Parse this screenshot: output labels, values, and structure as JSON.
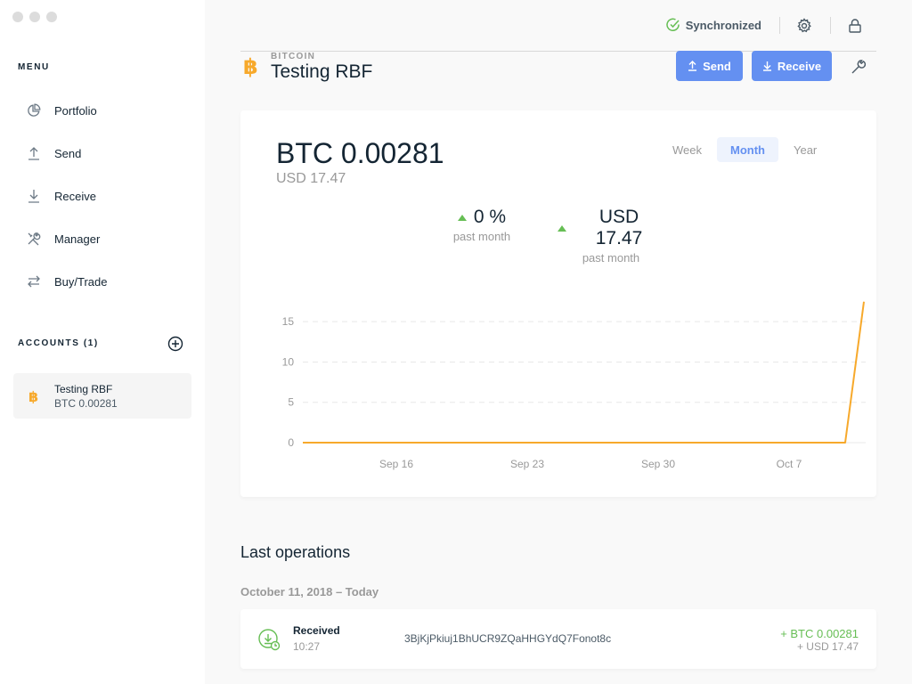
{
  "sidebar": {
    "menu_title": "MENU",
    "items": [
      {
        "label": "Portfolio",
        "icon": "pie-chart-icon"
      },
      {
        "label": "Send",
        "icon": "upload-arrow-icon"
      },
      {
        "label": "Receive",
        "icon": "download-arrow-icon"
      },
      {
        "label": "Manager",
        "icon": "tools-icon"
      },
      {
        "label": "Buy/Trade",
        "icon": "exchange-arrows-icon"
      }
    ],
    "accounts_title": "ACCOUNTS (1)",
    "accounts": [
      {
        "name": "Testing RBF",
        "balance": "BTC 0.00281",
        "icon": "bitcoin-icon"
      }
    ]
  },
  "topbar": {
    "sync_label": "Synchronized",
    "colors": {
      "sync": "#66be54"
    }
  },
  "account": {
    "currency_label": "BITCOIN",
    "name": "Testing RBF",
    "send_label": "Send",
    "receive_label": "Receive",
    "colors": {
      "bitcoin": "#f7a92b",
      "primary": "#6490f1"
    }
  },
  "balance": {
    "crypto": "BTC 0.00281",
    "fiat": "USD 17.47",
    "periods": [
      "Week",
      "Month",
      "Year"
    ],
    "active_period": "Month",
    "stats": [
      {
        "value": "0 %",
        "label": "past month"
      },
      {
        "value": "USD 17.47",
        "label": "past month"
      }
    ]
  },
  "chart_data": {
    "type": "line",
    "x_ticks": [
      "Sep 16",
      "Sep 23",
      "Sep 30",
      "Oct 7"
    ],
    "y_ticks": [
      0,
      5,
      10,
      15
    ],
    "ylim": [
      0,
      18
    ],
    "x_dates": [
      "2018-09-11",
      "2018-09-16",
      "2018-09-23",
      "2018-09-30",
      "2018-10-07",
      "2018-10-10",
      "2018-10-11"
    ],
    "values": [
      0,
      0,
      0,
      0,
      0,
      0,
      17.47
    ],
    "color": "#f7a92b",
    "grid": true
  },
  "operations": {
    "title": "Last operations",
    "groups": [
      {
        "date": "October 11, 2018 – Today",
        "rows": [
          {
            "type": "Received",
            "time": "10:27",
            "address": "3BjKjPkiuj1BhUCR9ZQaHHGYdQ7Fonot8c",
            "amount": "+ BTC 0.00281",
            "fiat": "+ USD 17.47"
          }
        ]
      }
    ]
  }
}
